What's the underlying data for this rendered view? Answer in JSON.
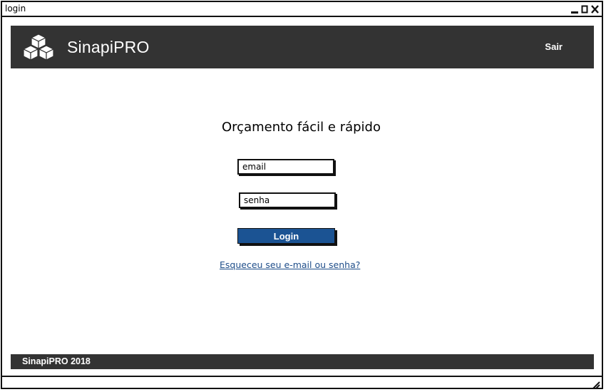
{
  "window": {
    "title": "login",
    "minimize_icon": "minimize-icon",
    "maximize_icon": "maximize-icon",
    "close_icon": "close-icon"
  },
  "header": {
    "logo_icon": "cubes-logo-icon",
    "brand": "SinapiPRO",
    "logout_label": "Sair",
    "background": "#333333"
  },
  "main": {
    "headline": "Orçamento fácil e rápido",
    "email": {
      "value": "",
      "placeholder": "email"
    },
    "password": {
      "value": "",
      "placeholder": "senha"
    },
    "login_label": "Login",
    "login_color": "#1b5393",
    "forgot_link": "Esqueceu seu e-mail ou senha?"
  },
  "footer": {
    "text": "SinapiPRO 2018"
  }
}
